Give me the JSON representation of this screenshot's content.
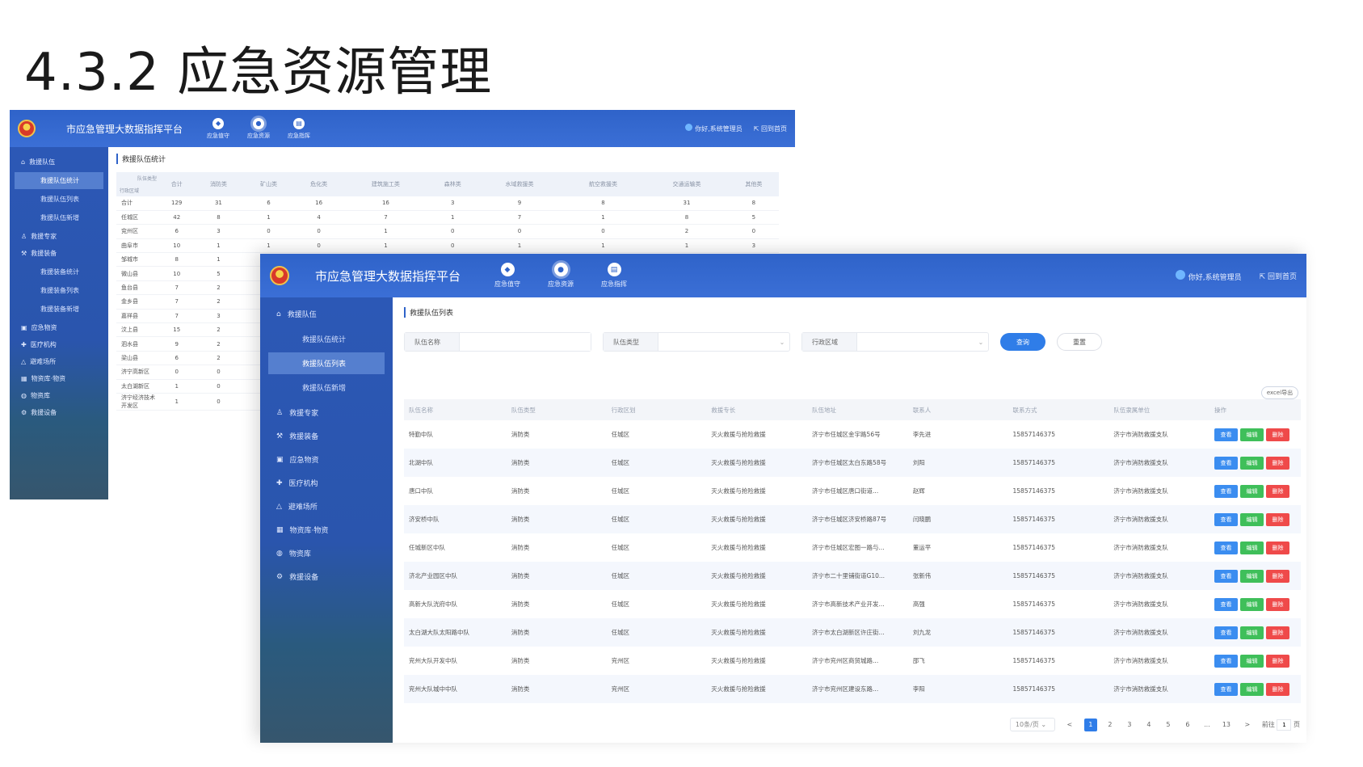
{
  "slide_title": "4.3.2 应急资源管理",
  "app": {
    "system_title": "市应急管理大数据指挥平台",
    "top_nav": [
      "应急值守",
      "应急资源",
      "应急指挥"
    ],
    "user_greeting": "你好,系统管理员",
    "home_link": "回到首页"
  },
  "back_window": {
    "sidebar": [
      {
        "label": "救援队伍",
        "children": [
          "救援队伍统计",
          "救援队伍列表",
          "救援队伍新增"
        ]
      },
      {
        "label": "救援专家"
      },
      {
        "label": "救援装备",
        "children": [
          "救援装备统计",
          "救援装备列表",
          "救援装备新增"
        ]
      },
      {
        "label": "应急物资"
      },
      {
        "label": "医疗机构"
      },
      {
        "label": "避难场所"
      },
      {
        "label": "物资库·物资"
      },
      {
        "label": "物资库"
      },
      {
        "label": "救援设备"
      }
    ],
    "section_title": "救援队伍统计",
    "table": {
      "corner_top": "队伍类型",
      "corner_bottom": "行政区域",
      "columns": [
        "合计",
        "消防类",
        "矿山类",
        "危化类",
        "建筑施工类",
        "森林类",
        "水域救援类",
        "航空救援类",
        "交通运输类",
        "其他类"
      ],
      "rows": [
        {
          "area": "合计",
          "values": [
            "129",
            "31",
            "6",
            "16",
            "16",
            "3",
            "9",
            "8",
            "31",
            "8"
          ]
        },
        {
          "area": "任城区",
          "values": [
            "42",
            "8",
            "1",
            "4",
            "7",
            "1",
            "7",
            "1",
            "8",
            "5"
          ]
        },
        {
          "area": "兖州区",
          "values": [
            "6",
            "3",
            "0",
            "0",
            "1",
            "0",
            "0",
            "0",
            "2",
            "0"
          ]
        },
        {
          "area": "曲阜市",
          "values": [
            "10",
            "1",
            "1",
            "0",
            "1",
            "0",
            "1",
            "1",
            "1",
            "3"
          ]
        },
        {
          "area": "邹城市",
          "values": [
            "8",
            "1",
            "",
            "",
            "",
            "",
            "",
            "",
            "",
            ""
          ]
        },
        {
          "area": "微山县",
          "values": [
            "10",
            "5",
            "",
            "",
            "",
            "",
            "",
            "",
            "",
            ""
          ]
        },
        {
          "area": "鱼台县",
          "values": [
            "7",
            "2",
            "",
            "",
            "",
            "",
            "",
            "",
            "",
            ""
          ]
        },
        {
          "area": "金乡县",
          "values": [
            "7",
            "2",
            "",
            "",
            "",
            "",
            "",
            "",
            "",
            ""
          ]
        },
        {
          "area": "嘉祥县",
          "values": [
            "7",
            "3",
            "",
            "",
            "",
            "",
            "",
            "",
            "",
            ""
          ]
        },
        {
          "area": "汶上县",
          "values": [
            "15",
            "2",
            "",
            "",
            "",
            "",
            "",
            "",
            "",
            ""
          ]
        },
        {
          "area": "泗水县",
          "values": [
            "9",
            "2",
            "",
            "",
            "",
            "",
            "",
            "",
            "",
            ""
          ]
        },
        {
          "area": "梁山县",
          "values": [
            "6",
            "2",
            "",
            "",
            "",
            "",
            "",
            "",
            "",
            ""
          ]
        },
        {
          "area": "济宁高新区",
          "values": [
            "0",
            "0",
            "",
            "",
            "",
            "",
            "",
            "",
            "",
            ""
          ]
        },
        {
          "area": "太白湖新区",
          "values": [
            "1",
            "0",
            "",
            "",
            "",
            "",
            "",
            "",
            "",
            ""
          ]
        },
        {
          "area": "济宁经济技术开发区",
          "values": [
            "1",
            "0",
            "",
            "",
            "",
            "",
            "",
            "",
            "",
            ""
          ]
        }
      ]
    }
  },
  "front_window": {
    "sidebar": [
      {
        "label": "救援队伍",
        "children": [
          "救援队伍统计",
          "救援队伍列表",
          "救援队伍新增"
        ]
      },
      {
        "label": "救援专家"
      },
      {
        "label": "救援装备"
      },
      {
        "label": "应急物资"
      },
      {
        "label": "医疗机构"
      },
      {
        "label": "避难场所"
      },
      {
        "label": "物资库·物资"
      },
      {
        "label": "物资库"
      },
      {
        "label": "救援设备"
      }
    ],
    "active_sub": "救援队伍列表",
    "section_title": "救援队伍列表",
    "filters": {
      "name_label": "队伍名称",
      "type_label": "队伍类型",
      "area_label": "行政区域",
      "query_button": "查询",
      "reset_button": "重置"
    },
    "export_button": "excel导出",
    "columns": [
      "队伍名称",
      "队伍类型",
      "行政区划",
      "救援专长",
      "队伍地址",
      "联系人",
      "联系方式",
      "队伍隶属单位",
      "操作"
    ],
    "rows": [
      [
        "特勤中队",
        "消防类",
        "任城区",
        "灭火救援与抢险救援",
        "济宁市任城区金宇路56号",
        "李先进",
        "15857146375",
        "济宁市消防救援支队"
      ],
      [
        "北湖中队",
        "消防类",
        "任城区",
        "灭火救援与抢险救援",
        "济宁市任城区太白东路58号",
        "刘阳",
        "15857146375",
        "济宁市消防救援支队"
      ],
      [
        "唐口中队",
        "消防类",
        "任城区",
        "灭火救援与抢险救援",
        "济宁市任城区唐口街道...",
        "赵辉",
        "15857146375",
        "济宁市消防救援支队"
      ],
      [
        "济安桥中队",
        "消防类",
        "任城区",
        "灭火救援与抢险救援",
        "济宁市任城区济安桥路87号",
        "闫晓鹏",
        "15857146375",
        "济宁市消防救援支队"
      ],
      [
        "任城新区中队",
        "消防类",
        "任城区",
        "灭火救援与抢险救援",
        "济宁市任城区宏图一路与...",
        "董运平",
        "15857146375",
        "济宁市消防救援支队"
      ],
      [
        "济北产业园区中队",
        "消防类",
        "任城区",
        "灭火救援与抢险救援",
        "济宁市二十里铺街道G10...",
        "张新伟",
        "15857146375",
        "济宁市消防救援支队"
      ],
      [
        "高新大队洸府中队",
        "消防类",
        "任城区",
        "灭火救援与抢险救援",
        "济宁市高新技术产业开发...",
        "高强",
        "15857146375",
        "济宁市消防救援支队"
      ],
      [
        "太白湖大队太阳路中队",
        "消防类",
        "任城区",
        "灭火救援与抢险救援",
        "济宁市太白湖新区许庄街...",
        "刘九龙",
        "15857146375",
        "济宁市消防救援支队"
      ],
      [
        "兖州大队开发中队",
        "消防类",
        "兖州区",
        "灭火救援与抢险救援",
        "济宁市兖州区商贸城路...",
        "邵飞",
        "15857146375",
        "济宁市消防救援支队"
      ],
      [
        "兖州大队城中中队",
        "消防类",
        "兖州区",
        "灭火救援与抢险救援",
        "济宁市兖州区建设东路...",
        "李阳",
        "15857146375",
        "济宁市消防救援支队"
      ]
    ],
    "row_actions": {
      "view": "查看",
      "edit": "编辑",
      "delete": "删除"
    },
    "pagination": {
      "page_size": "10条/页",
      "prev": "<",
      "pages": [
        "1",
        "2",
        "3",
        "4",
        "5",
        "6",
        "...",
        "13"
      ],
      "next": ">",
      "goto_prefix": "前往",
      "goto_value": "1",
      "goto_suffix": "页"
    }
  }
}
